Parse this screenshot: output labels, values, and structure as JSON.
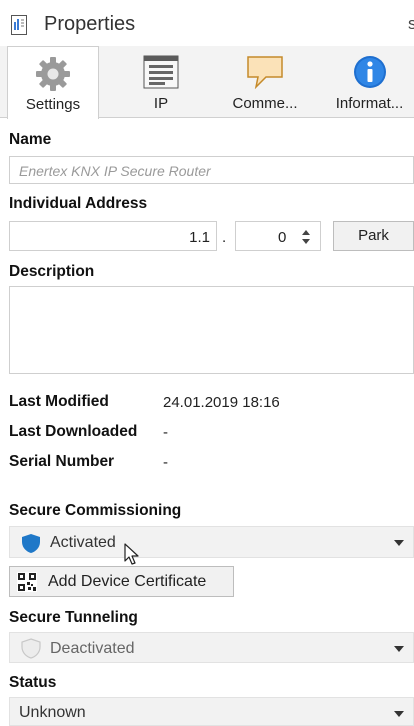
{
  "panel": {
    "title": "Properties",
    "edge_glyph": "s"
  },
  "tabs": [
    {
      "label": "Settings",
      "icon": "gear-icon",
      "active": true
    },
    {
      "label": "IP",
      "icon": "ip-icon",
      "active": false
    },
    {
      "label": "Comme...",
      "icon": "comment-icon",
      "active": false
    },
    {
      "label": "Informat...",
      "icon": "info-icon",
      "active": false
    }
  ],
  "name": {
    "label": "Name",
    "placeholder": "Enertex KNX IP Secure Router"
  },
  "individual_address": {
    "label": "Individual Address",
    "area_line": "1.1",
    "separator": ".",
    "device": "0",
    "park_label": "Park"
  },
  "description": {
    "label": "Description",
    "value": ""
  },
  "info": [
    {
      "label": "Last Modified",
      "value": "24.01.2019 18:16"
    },
    {
      "label": "Last Downloaded",
      "value": "-"
    },
    {
      "label": "Serial Number",
      "value": "-"
    }
  ],
  "secure_commissioning": {
    "label": "Secure Commissioning",
    "value": "Activated",
    "icon": "shield-icon",
    "shield_color": "#1f78c8"
  },
  "add_cert": {
    "label": "Add Device Certificate",
    "icon": "qr-code-icon"
  },
  "secure_tunneling": {
    "label": "Secure Tunneling",
    "value": "Deactivated",
    "icon": "shield-outline-icon"
  },
  "status": {
    "label": "Status",
    "value": "Unknown"
  }
}
